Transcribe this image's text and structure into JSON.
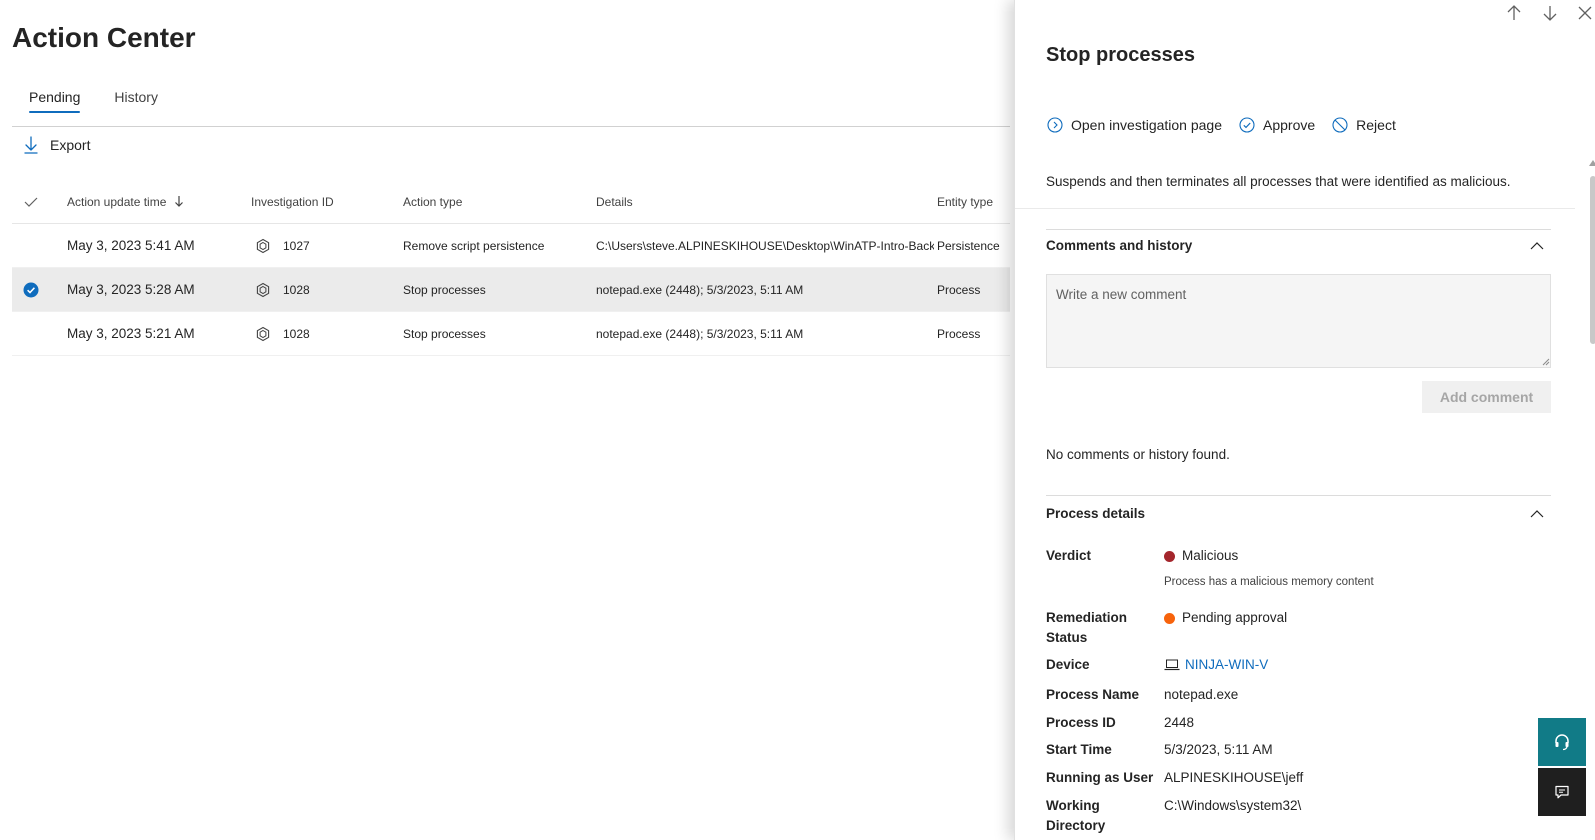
{
  "main": {
    "title": "Action Center",
    "tabs": [
      {
        "label": "Pending",
        "active": true
      },
      {
        "label": "History",
        "active": false
      }
    ],
    "export_label": "Export",
    "columns": {
      "action_update_time": "Action update time",
      "investigation_id": "Investigation ID",
      "action_type": "Action type",
      "details": "Details",
      "entity_type": "Entity type"
    },
    "rows": [
      {
        "time": "May 3, 2023 5:41 AM",
        "investigation_id": "1027",
        "action_type": "Remove script persistence",
        "details": "C:\\Users\\steve.ALPINESKIHOUSE\\Desktop\\WinATP-Intro-Backd",
        "entity_type": "Persistence",
        "selected": false
      },
      {
        "time": "May 3, 2023 5:28 AM",
        "investigation_id": "1028",
        "action_type": "Stop processes",
        "details": "notepad.exe (2448); 5/3/2023, 5:11 AM",
        "entity_type": "Process",
        "selected": true
      },
      {
        "time": "May 3, 2023 5:21 AM",
        "investigation_id": "1028",
        "action_type": "Stop processes",
        "details": "notepad.exe (2448); 5/3/2023, 5:11 AM",
        "entity_type": "Process",
        "selected": false
      }
    ]
  },
  "panel": {
    "title": "Stop processes",
    "commands": {
      "open_investigation": "Open investigation page",
      "approve": "Approve",
      "reject": "Reject"
    },
    "description": "Suspends and then terminates all processes that were identified as malicious.",
    "comments": {
      "heading": "Comments and history",
      "placeholder": "Write a new comment",
      "add_button": "Add comment",
      "empty_text": "No comments or history found."
    },
    "process_details": {
      "heading": "Process details",
      "verdict_label": "Verdict",
      "verdict_value": "Malicious",
      "verdict_color": "#a4262c",
      "verdict_note": "Process has a malicious memory content",
      "remediation_label_1": "Remediation",
      "remediation_label_2": "Status",
      "remediation_value": "Pending approval",
      "remediation_color": "#f7630c",
      "device_label": "Device",
      "device_value": "NINJA-WIN-V",
      "process_name_label": "Process Name",
      "process_name_value": "notepad.exe",
      "process_id_label": "Process ID",
      "process_id_value": "2448",
      "start_time_label": "Start Time",
      "start_time_value": "5/3/2023, 5:11 AM",
      "running_as_label": "Running as User",
      "running_as_value": "ALPINESKIHOUSE\\jeff",
      "working_dir_label_1": "Working",
      "working_dir_label_2": "Directory",
      "working_dir_value": "C:\\Windows\\system32\\"
    }
  },
  "colors": {
    "accent": "#0f6cbd",
    "help_button": "#117b87",
    "chat_button": "#1f1f1f"
  },
  "icons": {
    "export": "download-icon",
    "investigation": "hexagon-icon",
    "open_investigation": "chevron-circle-icon",
    "approve": "check-circle-icon",
    "reject": "prohibited-icon",
    "device": "laptop-icon",
    "help": "headset-icon",
    "chat": "chat-icon"
  }
}
